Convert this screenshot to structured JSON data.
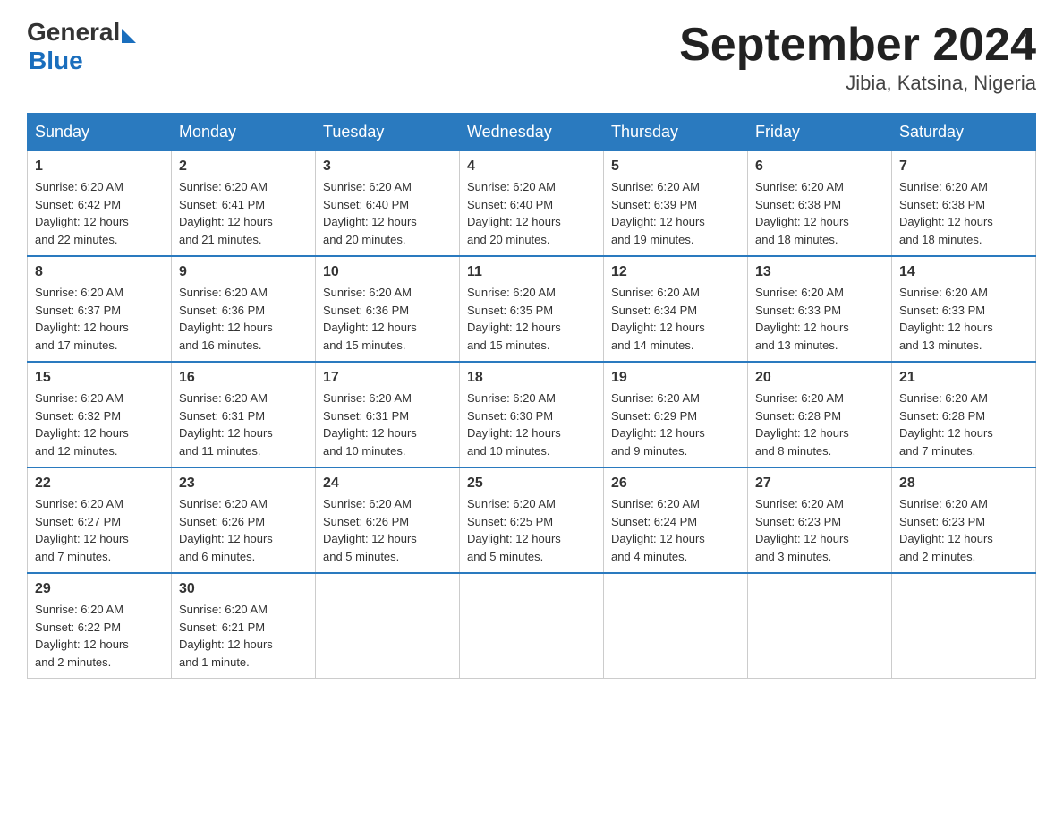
{
  "header": {
    "logo_general": "General",
    "logo_blue": "Blue",
    "month_title": "September 2024",
    "location": "Jibia, Katsina, Nigeria"
  },
  "weekdays": [
    "Sunday",
    "Monday",
    "Tuesday",
    "Wednesday",
    "Thursday",
    "Friday",
    "Saturday"
  ],
  "weeks": [
    [
      {
        "day": "1",
        "sunrise": "6:20 AM",
        "sunset": "6:42 PM",
        "daylight": "12 hours and 22 minutes."
      },
      {
        "day": "2",
        "sunrise": "6:20 AM",
        "sunset": "6:41 PM",
        "daylight": "12 hours and 21 minutes."
      },
      {
        "day": "3",
        "sunrise": "6:20 AM",
        "sunset": "6:40 PM",
        "daylight": "12 hours and 20 minutes."
      },
      {
        "day": "4",
        "sunrise": "6:20 AM",
        "sunset": "6:40 PM",
        "daylight": "12 hours and 20 minutes."
      },
      {
        "day": "5",
        "sunrise": "6:20 AM",
        "sunset": "6:39 PM",
        "daylight": "12 hours and 19 minutes."
      },
      {
        "day": "6",
        "sunrise": "6:20 AM",
        "sunset": "6:38 PM",
        "daylight": "12 hours and 18 minutes."
      },
      {
        "day": "7",
        "sunrise": "6:20 AM",
        "sunset": "6:38 PM",
        "daylight": "12 hours and 18 minutes."
      }
    ],
    [
      {
        "day": "8",
        "sunrise": "6:20 AM",
        "sunset": "6:37 PM",
        "daylight": "12 hours and 17 minutes."
      },
      {
        "day": "9",
        "sunrise": "6:20 AM",
        "sunset": "6:36 PM",
        "daylight": "12 hours and 16 minutes."
      },
      {
        "day": "10",
        "sunrise": "6:20 AM",
        "sunset": "6:36 PM",
        "daylight": "12 hours and 15 minutes."
      },
      {
        "day": "11",
        "sunrise": "6:20 AM",
        "sunset": "6:35 PM",
        "daylight": "12 hours and 15 minutes."
      },
      {
        "day": "12",
        "sunrise": "6:20 AM",
        "sunset": "6:34 PM",
        "daylight": "12 hours and 14 minutes."
      },
      {
        "day": "13",
        "sunrise": "6:20 AM",
        "sunset": "6:33 PM",
        "daylight": "12 hours and 13 minutes."
      },
      {
        "day": "14",
        "sunrise": "6:20 AM",
        "sunset": "6:33 PM",
        "daylight": "12 hours and 13 minutes."
      }
    ],
    [
      {
        "day": "15",
        "sunrise": "6:20 AM",
        "sunset": "6:32 PM",
        "daylight": "12 hours and 12 minutes."
      },
      {
        "day": "16",
        "sunrise": "6:20 AM",
        "sunset": "6:31 PM",
        "daylight": "12 hours and 11 minutes."
      },
      {
        "day": "17",
        "sunrise": "6:20 AM",
        "sunset": "6:31 PM",
        "daylight": "12 hours and 10 minutes."
      },
      {
        "day": "18",
        "sunrise": "6:20 AM",
        "sunset": "6:30 PM",
        "daylight": "12 hours and 10 minutes."
      },
      {
        "day": "19",
        "sunrise": "6:20 AM",
        "sunset": "6:29 PM",
        "daylight": "12 hours and 9 minutes."
      },
      {
        "day": "20",
        "sunrise": "6:20 AM",
        "sunset": "6:28 PM",
        "daylight": "12 hours and 8 minutes."
      },
      {
        "day": "21",
        "sunrise": "6:20 AM",
        "sunset": "6:28 PM",
        "daylight": "12 hours and 7 minutes."
      }
    ],
    [
      {
        "day": "22",
        "sunrise": "6:20 AM",
        "sunset": "6:27 PM",
        "daylight": "12 hours and 7 minutes."
      },
      {
        "day": "23",
        "sunrise": "6:20 AM",
        "sunset": "6:26 PM",
        "daylight": "12 hours and 6 minutes."
      },
      {
        "day": "24",
        "sunrise": "6:20 AM",
        "sunset": "6:26 PM",
        "daylight": "12 hours and 5 minutes."
      },
      {
        "day": "25",
        "sunrise": "6:20 AM",
        "sunset": "6:25 PM",
        "daylight": "12 hours and 5 minutes."
      },
      {
        "day": "26",
        "sunrise": "6:20 AM",
        "sunset": "6:24 PM",
        "daylight": "12 hours and 4 minutes."
      },
      {
        "day": "27",
        "sunrise": "6:20 AM",
        "sunset": "6:23 PM",
        "daylight": "12 hours and 3 minutes."
      },
      {
        "day": "28",
        "sunrise": "6:20 AM",
        "sunset": "6:23 PM",
        "daylight": "12 hours and 2 minutes."
      }
    ],
    [
      {
        "day": "29",
        "sunrise": "6:20 AM",
        "sunset": "6:22 PM",
        "daylight": "12 hours and 2 minutes."
      },
      {
        "day": "30",
        "sunrise": "6:20 AM",
        "sunset": "6:21 PM",
        "daylight": "12 hours and 1 minute."
      },
      null,
      null,
      null,
      null,
      null
    ]
  ],
  "labels": {
    "sunrise": "Sunrise:",
    "sunset": "Sunset:",
    "daylight": "Daylight:"
  }
}
